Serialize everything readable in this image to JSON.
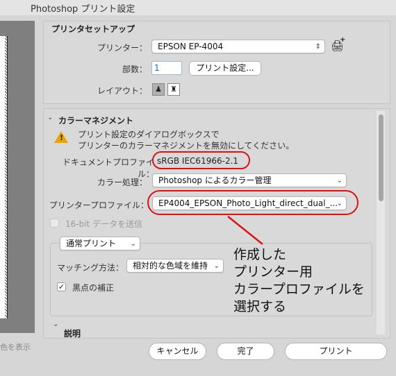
{
  "window": {
    "title": "Photoshop プリント設定"
  },
  "printer_setup": {
    "title": "プリンタセットアップ",
    "printer_label": "プリンター：",
    "printer_value": "EPSON EP-4004",
    "copies_label": "部数：",
    "copies_value": "1",
    "print_settings_button": "プリント設定...",
    "layout_label": "レイアウト："
  },
  "color_management": {
    "title": "カラーマネジメント",
    "warning_line1": "プリント設定のダイアログボックスで",
    "warning_line2": "プリンターのカラーマネジメントを無効にしてください。",
    "doc_profile_label": "ドキュメントプロファイル：",
    "doc_profile_value": "sRGB IEC61966-2.1",
    "color_handling_label": "カラー処理：",
    "color_handling_value": "Photoshop によるカラー管理",
    "printer_profile_label": "プリンタープロファイル：",
    "printer_profile_value": "EP4004_EPSON_Photo_Light_direct_dual_...",
    "bit16_label": "16-bit データを送信",
    "print_mode_value": "通常プリント",
    "matching_label": "マッチング方法：",
    "matching_value": "相対的な色域を維持",
    "black_point_label": "黒点の補正",
    "description_title": "説明"
  },
  "annotation": {
    "lines": [
      "作成した",
      "プリンター用",
      "カラープロファイルを",
      "選択する"
    ],
    "color": "#e01010"
  },
  "footer": {
    "cutoff_text": "色を表示",
    "cancel_button": "キャンセル",
    "done_button": "完了",
    "print_button": "プリント"
  }
}
